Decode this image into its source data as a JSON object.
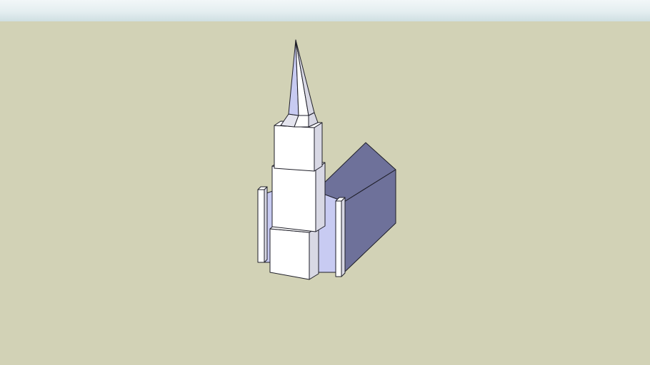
{
  "colors": {
    "sky_top": "#f2f7f8",
    "sky_bottom": "#cfdfe2",
    "ground": "#d2d2b6",
    "face_front": "#ffffff",
    "face_side_light": "#d8d8e4",
    "face_lavender": "#c8cbf2",
    "face_dark": "#6e719a",
    "edge": "#1e1e28"
  }
}
